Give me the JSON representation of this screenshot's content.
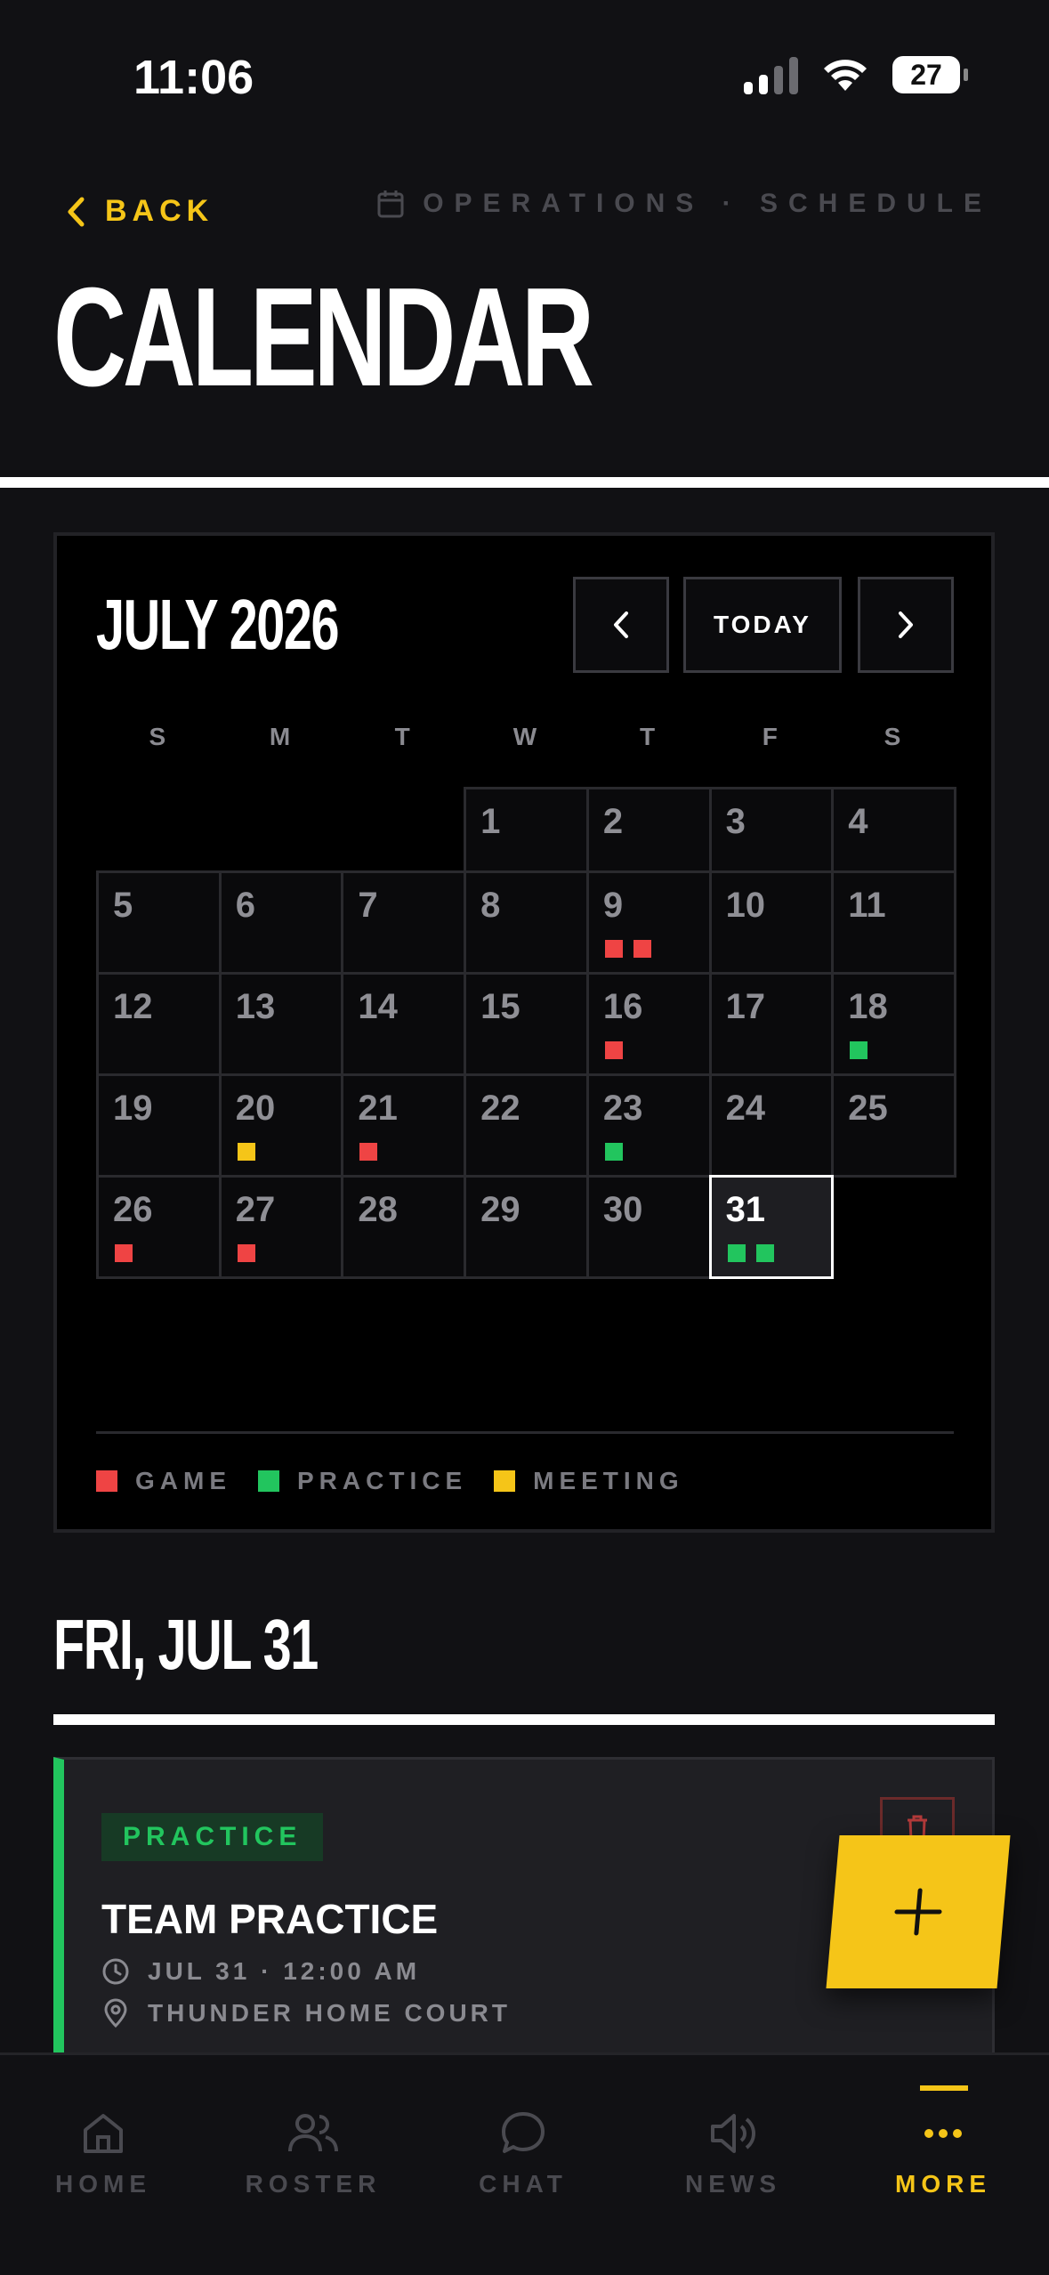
{
  "status": {
    "time": "11:06",
    "battery": "27"
  },
  "header": {
    "back_label": "BACK",
    "breadcrumb": "OPERATIONS · SCHEDULE",
    "title": "CALENDAR"
  },
  "calendar": {
    "month_label": "JULY 2026",
    "today_label": "TODAY",
    "weekdays": [
      "S",
      "M",
      "T",
      "W",
      "T",
      "F",
      "S"
    ],
    "first_weekday_index": 3,
    "days_in_month": 31,
    "selected_day": 31,
    "events": {
      "9": [
        "game",
        "game"
      ],
      "16": [
        "game"
      ],
      "18": [
        "practice"
      ],
      "20": [
        "meeting"
      ],
      "21": [
        "game"
      ],
      "23": [
        "practice"
      ],
      "26": [
        "game"
      ],
      "27": [
        "game"
      ],
      "31": [
        "practice",
        "practice"
      ]
    },
    "legend": [
      {
        "type": "game",
        "label": "GAME"
      },
      {
        "type": "practice",
        "label": "PRACTICE"
      },
      {
        "type": "meeting",
        "label": "MEETING"
      }
    ]
  },
  "selected": {
    "date_label": "FRI, JUL 31",
    "event": {
      "tag": "PRACTICE",
      "title": "TEAM PRACTICE",
      "time": "JUL 31 · 12:00 AM",
      "location": "THUNDER HOME COURT"
    }
  },
  "bottom_nav": [
    {
      "id": "home",
      "label": "HOME",
      "active": false
    },
    {
      "id": "roster",
      "label": "ROSTER",
      "active": false
    },
    {
      "id": "chat",
      "label": "CHAT",
      "active": false
    },
    {
      "id": "news",
      "label": "NEWS",
      "active": false
    },
    {
      "id": "more",
      "label": "MORE",
      "active": true
    }
  ],
  "colors": {
    "accent": "#f5c518",
    "game": "#ef4444",
    "practice": "#22c55e",
    "meeting": "#f5c518"
  }
}
